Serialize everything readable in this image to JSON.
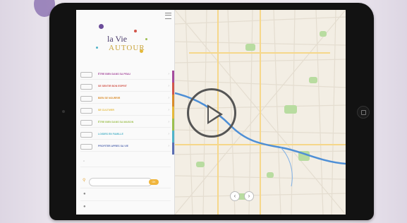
{
  "app": {
    "logo_line1": "la Vie",
    "logo_line2": "AUTOUR"
  },
  "sidebar": {
    "items": [
      {
        "label": "ÊTRE BIEN DANS SA PEAU",
        "color": "#a64b9c"
      },
      {
        "label": "SE SENTIR BON ESPRIT",
        "color": "#d2554a"
      },
      {
        "label": "BIEN SE NOURRIR",
        "color": "#d98c2b"
      },
      {
        "label": "SE CULTIVER",
        "color": "#e4b93a"
      },
      {
        "label": "ÊTRE BIEN DANS SA MAISON",
        "color": "#9cbf4e"
      },
      {
        "label": "LOISIRS EN FAMILLE",
        "color": "#4fb3c8"
      },
      {
        "label": "PROFITER APRES SA VIE",
        "color": "#5b6fb3"
      }
    ],
    "search_placeholder": "",
    "search_button": "OK",
    "bottom_links": [
      "",
      ""
    ]
  },
  "player": {
    "play_label": "play-icon"
  },
  "map_controls": {
    "prev": "‹",
    "next": "›"
  }
}
